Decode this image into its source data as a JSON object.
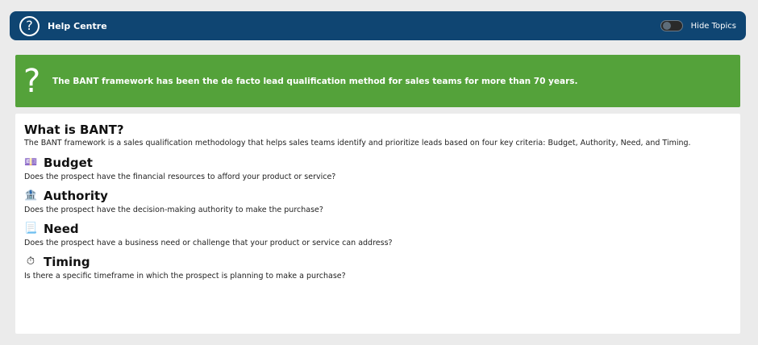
{
  "header": {
    "icon": "help-circle-icon",
    "title": "Help Centre",
    "toggle_label": "Hide Topics"
  },
  "banner": {
    "icon": "question-mark-icon",
    "text": "The BANT framework has been the de facto lead qualification method for sales teams for more than 70 years."
  },
  "content": {
    "title": "What is BANT?",
    "description": "The BANT framework is a sales qualification methodology that helps sales teams identify and prioritize leads based on four key criteria: Budget, Authority, Need, and Timing.",
    "sections": [
      {
        "icon": "money-icon",
        "glyph": "💷",
        "title": "Budget",
        "description": "Does the prospect have the financial resources to afford your product or service?"
      },
      {
        "icon": "bank-icon",
        "glyph": "🏦",
        "title": "Authority",
        "description": "Does the prospect have the decision-making authority to make the purchase?"
      },
      {
        "icon": "document-icon",
        "glyph": "📃",
        "title": "Need",
        "description": "Does the prospect have a business need or challenge that your product or service can address?"
      },
      {
        "icon": "stopwatch-icon",
        "glyph": "⏱",
        "title": "Timing",
        "description": "Is there a specific timeframe in which the prospect is planning to make a purchase?"
      }
    ]
  },
  "colors": {
    "header_bg": "#0f4572",
    "banner_bg": "#54a23a",
    "page_bg": "#ebebeb"
  }
}
